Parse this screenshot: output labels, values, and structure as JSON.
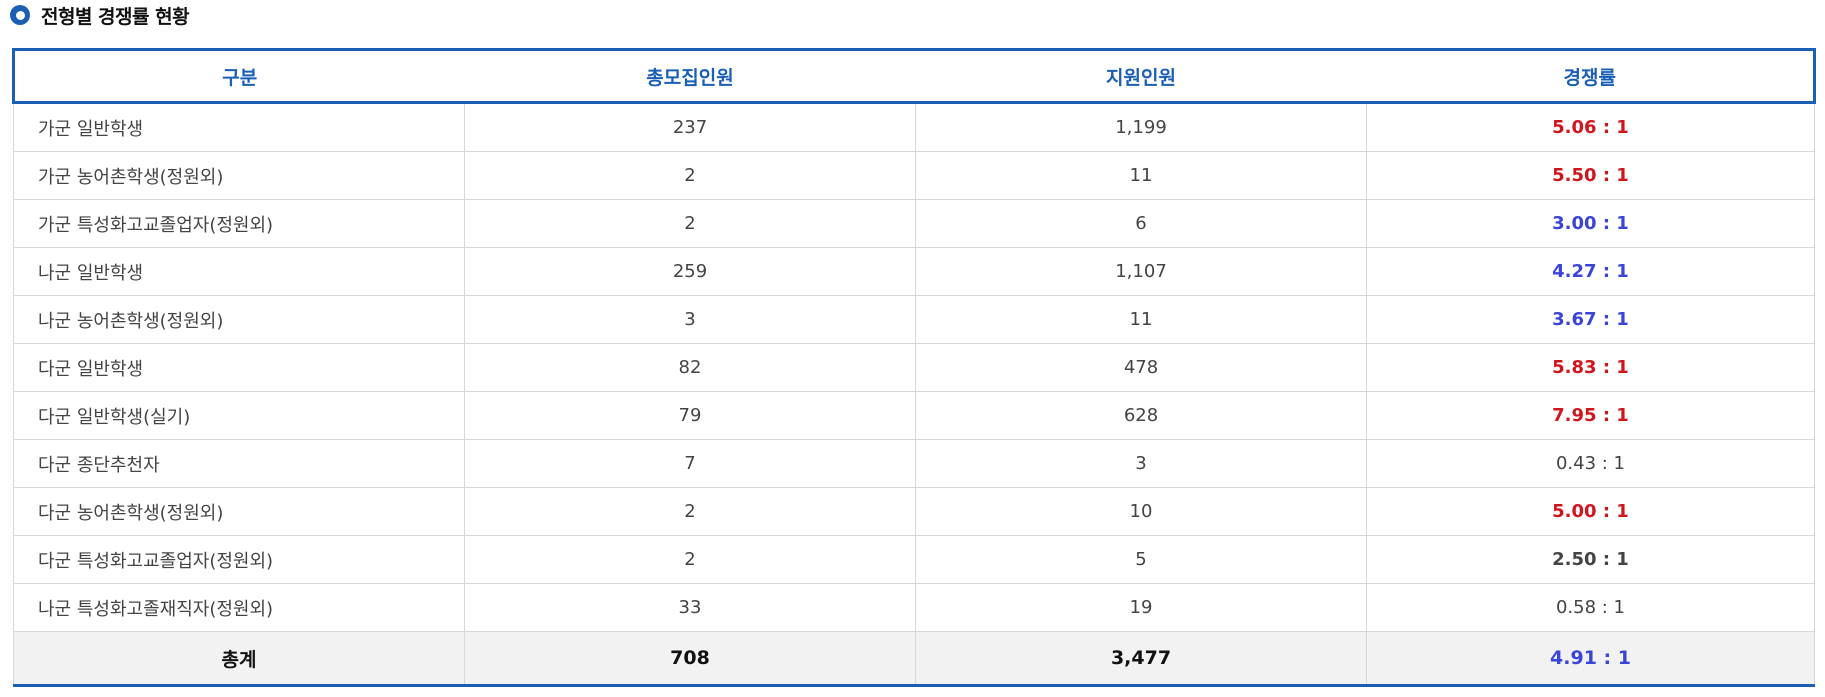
{
  "section": {
    "title": "전형별 경쟁률 현황"
  },
  "table": {
    "headers": [
      "구분",
      "총모집인원",
      "지원인원",
      "경쟁률"
    ],
    "rows": [
      {
        "category": "가군 일반학생",
        "recruit": "237",
        "applicants": "1,199",
        "rate": "5.06 : 1",
        "rate_color": "red"
      },
      {
        "category": "가군 농어촌학생(정원외)",
        "recruit": "2",
        "applicants": "11",
        "rate": "5.50 : 1",
        "rate_color": "red"
      },
      {
        "category": "가군 특성화고교졸업자(정원외)",
        "recruit": "2",
        "applicants": "6",
        "rate": "3.00 : 1",
        "rate_color": "blue"
      },
      {
        "category": "나군 일반학생",
        "recruit": "259",
        "applicants": "1,107",
        "rate": "4.27 : 1",
        "rate_color": "blue"
      },
      {
        "category": "나군 농어촌학생(정원외)",
        "recruit": "3",
        "applicants": "11",
        "rate": "3.67 : 1",
        "rate_color": "blue"
      },
      {
        "category": "다군 일반학생",
        "recruit": "82",
        "applicants": "478",
        "rate": "5.83 : 1",
        "rate_color": "red"
      },
      {
        "category": "다군 일반학생(실기)",
        "recruit": "79",
        "applicants": "628",
        "rate": "7.95 : 1",
        "rate_color": "red"
      },
      {
        "category": "다군 종단추천자",
        "recruit": "7",
        "applicants": "3",
        "rate": "0.43 : 1",
        "rate_color": "gray"
      },
      {
        "category": "다군 농어촌학생(정원외)",
        "recruit": "2",
        "applicants": "10",
        "rate": "5.00 : 1",
        "rate_color": "red"
      },
      {
        "category": "다군 특성화고교졸업자(정원외)",
        "recruit": "2",
        "applicants": "5",
        "rate": "2.50 : 1",
        "rate_color": "grayb"
      },
      {
        "category": "나군 특성화고졸재직자(정원외)",
        "recruit": "33",
        "applicants": "19",
        "rate": "0.58 : 1",
        "rate_color": "gray"
      }
    ],
    "total": {
      "label": "총계",
      "recruit": "708",
      "applicants": "3,477",
      "rate": "4.91 : 1"
    }
  },
  "colors": {
    "accent": "#1a5fb4",
    "rate_high": "#d0161d",
    "rate_mid": "#3a44d6",
    "text": "#444444",
    "total_bg": "#f2f2f2"
  }
}
